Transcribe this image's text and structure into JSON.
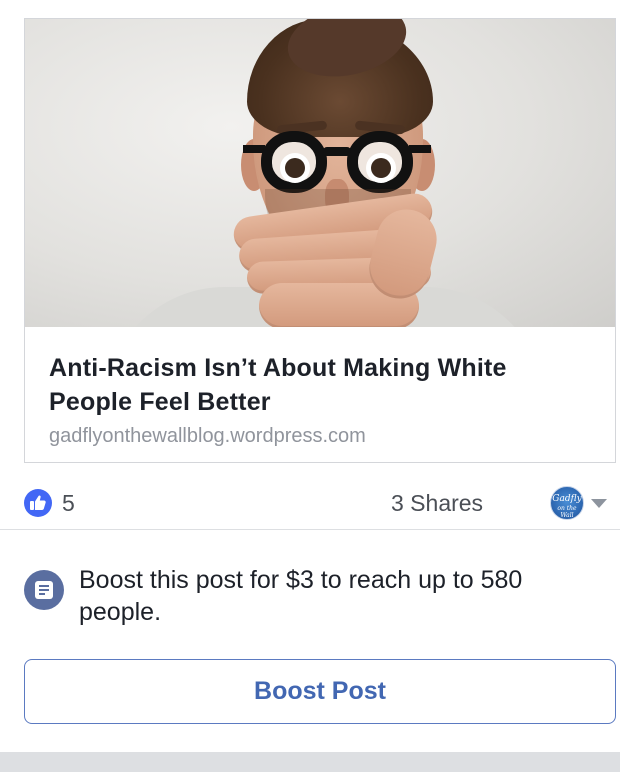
{
  "post": {
    "link_preview": {
      "image_subject": "man-covering-mouth-photo",
      "title": "Anti-Racism Isn’t About Making White People Feel Better",
      "domain": "gadflyonthewallblog.wordpress.com"
    },
    "stats": {
      "like_count": "5",
      "shares": "3 Shares",
      "page_avatar_text": "Gadfly",
      "page_avatar_subtext": "on the Wall"
    },
    "boost": {
      "message": "Boost this post for $3 to reach up to 580 people.",
      "button_label": "Boost Post"
    }
  },
  "icons": {
    "like": "thumbs-up-icon",
    "boost": "document-icon",
    "menu": "chevron-down-icon"
  },
  "colors": {
    "accent_blue": "#4267b2",
    "like_blue": "#4267f5",
    "secondary_text": "#90949c"
  }
}
